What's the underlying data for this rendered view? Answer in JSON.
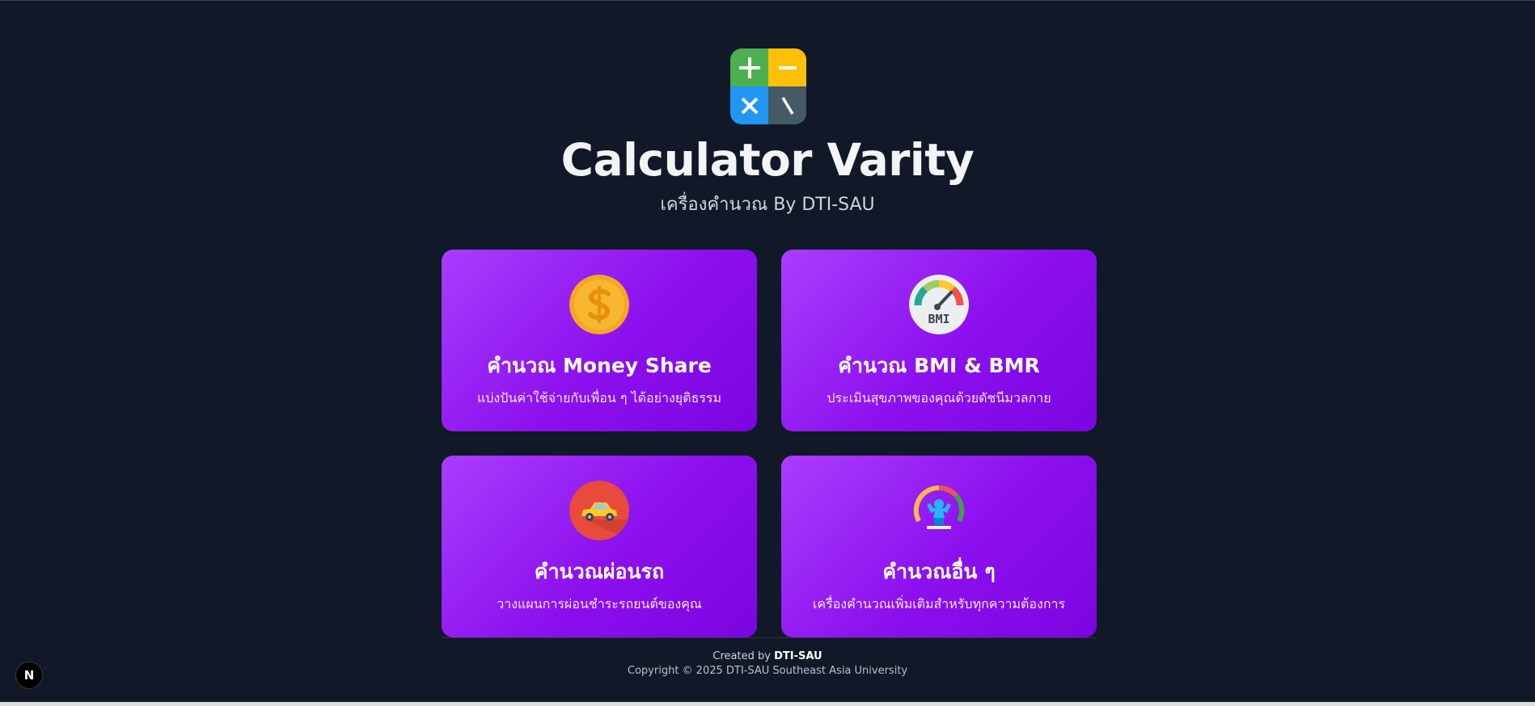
{
  "header": {
    "title": "Calculator Varity",
    "subtitle": "เครื่องคำนวณ By DTI-SAU"
  },
  "cards": [
    {
      "title": "คำนวณ Money Share",
      "description": "แบ่งปันค่าใช้จ่ายกับเพื่อน ๆ ได้อย่างยุติธรรม",
      "icon": "dollar-coin-icon"
    },
    {
      "title": "คำนวณ BMI & BMR",
      "description": "ประเมินสุขภาพของคุณด้วยดัชนีมวลกาย",
      "icon": "bmi-gauge-icon",
      "icon_text": "BMI"
    },
    {
      "title": "คำนวณผ่อนรถ",
      "description": "วางแผนการผ่อนชำระรถยนต์ของคุณ",
      "icon": "car-icon"
    },
    {
      "title": "คำนวณอื่น ๆ",
      "description": "เครื่องคำนวณเพิ่มเติมสำหรับทุกความต้องการ",
      "icon": "strong-person-icon"
    }
  ],
  "footer": {
    "created_prefix": "Created by",
    "created_by": "DTI-SAU",
    "copyright": "Copyright © 2025 DTI-SAU Southeast Asia University"
  },
  "dev_badge": {
    "label": "N"
  },
  "colors": {
    "background": "#111827",
    "card_gradient_start": "#a93dfc",
    "card_gradient_end": "#7b05e0",
    "logo_green": "#4caf50",
    "logo_yellow": "#ffc107",
    "logo_blue": "#2196f3",
    "logo_slate": "#455a64"
  }
}
